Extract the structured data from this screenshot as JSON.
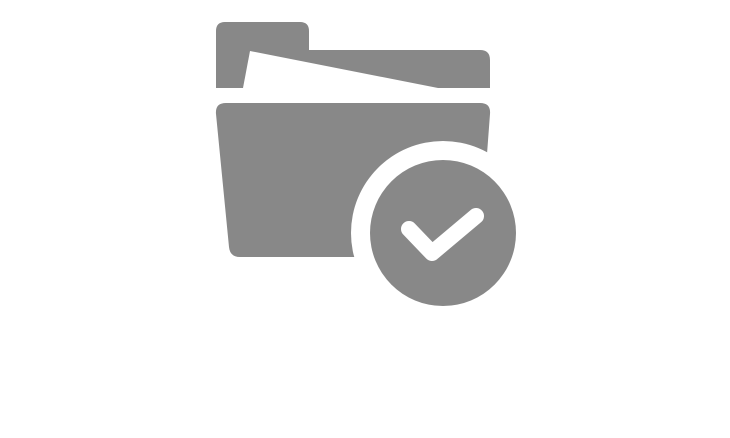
{
  "illustration": {
    "icon": "folder-check-icon",
    "color": "#888888",
    "background": "#ffffff"
  }
}
